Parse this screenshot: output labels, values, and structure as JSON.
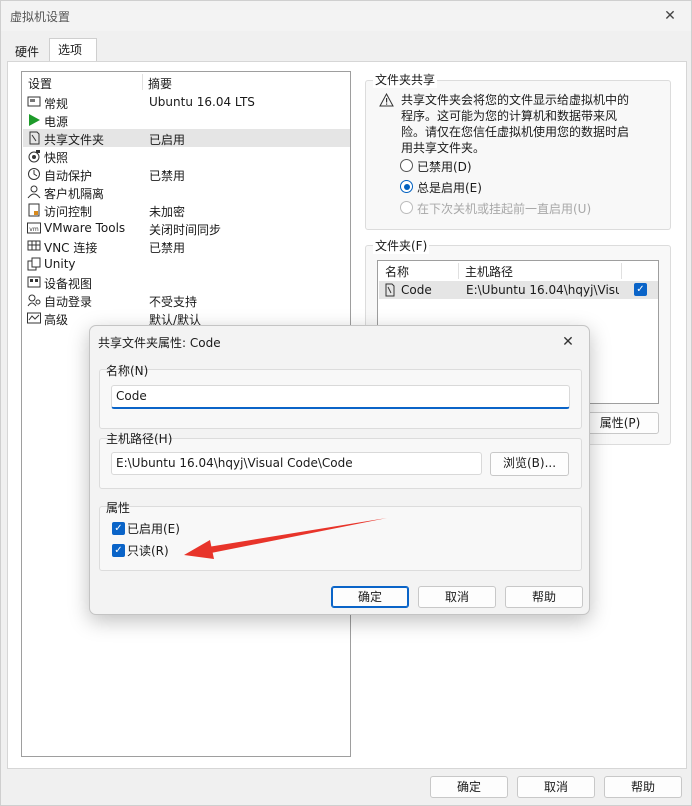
{
  "window": {
    "title": "虚拟机设置"
  },
  "tabs": [
    {
      "label": "硬件"
    },
    {
      "label": "选项"
    }
  ],
  "settings_list": {
    "headers": {
      "name": "设置",
      "summary": "摘要"
    },
    "items": [
      {
        "icon": "general-icon",
        "name": "常规",
        "summary": "Ubuntu 16.04 LTS"
      },
      {
        "icon": "power-icon",
        "name": "电源",
        "summary": ""
      },
      {
        "icon": "shared-folder-icon",
        "name": "共享文件夹",
        "summary": "已启用"
      },
      {
        "icon": "snapshot-icon",
        "name": "快照",
        "summary": ""
      },
      {
        "icon": "autoprotect-icon",
        "name": "自动保护",
        "summary": "已禁用"
      },
      {
        "icon": "guest-isolation-icon",
        "name": "客户机隔离",
        "summary": ""
      },
      {
        "icon": "access-control-icon",
        "name": "访问控制",
        "summary": "未加密"
      },
      {
        "icon": "vmware-tools-icon",
        "name": "VMware Tools",
        "summary": "关闭时间同步"
      },
      {
        "icon": "vnc-icon",
        "name": "VNC 连接",
        "summary": "已禁用"
      },
      {
        "icon": "unity-icon",
        "name": "Unity",
        "summary": ""
      },
      {
        "icon": "device-view-icon",
        "name": "设备视图",
        "summary": ""
      },
      {
        "icon": "autologin-icon",
        "name": "自动登录",
        "summary": "不受支持"
      },
      {
        "icon": "advanced-icon",
        "name": "高级",
        "summary": "默认/默认"
      }
    ]
  },
  "folder_sharing": {
    "group_label": "文件夹共享",
    "warning": "共享文件夹会将您的文件显示给虚拟机中的程序。这可能为您的计算机和数据带来风险。请仅在您信任虚拟机使用您的数据时启用共享文件夹。",
    "options": [
      {
        "label": "已禁用(D)",
        "state": "off"
      },
      {
        "label": "总是启用(E)",
        "state": "on"
      },
      {
        "label": "在下次关机或挂起前一直启用(U)",
        "state": "disabled"
      }
    ]
  },
  "folders": {
    "group_label": "文件夹(F)",
    "headers": {
      "name": "名称",
      "host_path": "主机路径"
    },
    "rows": [
      {
        "name": "Code",
        "host_path": "E:\\Ubuntu 16.04\\hqyj\\Visu...",
        "enabled": true
      }
    ],
    "properties_button": "属性(P)"
  },
  "bottom_buttons": {
    "ok": "确定",
    "cancel": "取消",
    "help": "帮助"
  },
  "dialog": {
    "title": "共享文件夹属性: Code",
    "name_group": "名称(N)",
    "name_value": "Code",
    "host_path_group": "主机路径(H)",
    "host_path_value": "E:\\Ubuntu 16.04\\hqyj\\Visual Code\\Code",
    "browse_button": "浏览(B)...",
    "attributes_group": "属性",
    "attributes": [
      {
        "label": "已启用(E)",
        "checked": true
      },
      {
        "label": "只读(R)",
        "checked": true
      }
    ],
    "buttons": {
      "ok": "确定",
      "cancel": "取消",
      "help": "帮助"
    }
  },
  "colors": {
    "accent": "#0a64c8",
    "annotation_arrow": "#e8342a"
  }
}
